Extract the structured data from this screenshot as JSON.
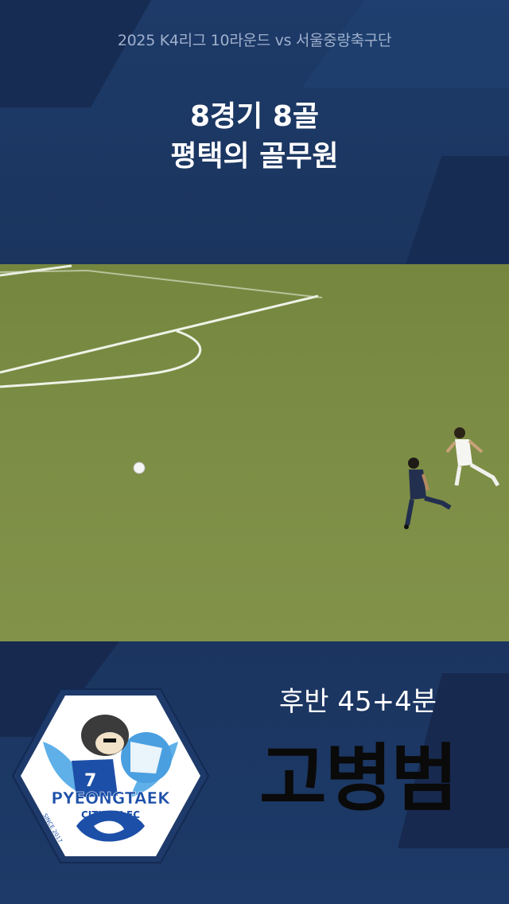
{
  "header": {
    "match_info": "2025 K4리그 10라운드 vs 서울중랑축구단",
    "headline_line1": "8경기 8골",
    "headline_line2": "평택의 골무원"
  },
  "caption": {
    "minute": "후반 45+4분",
    "player_name": "고병범"
  },
  "logo": {
    "name": "PYEONGTAEK",
    "sub": "CITIZEN FC",
    "since": "SINCE 2017",
    "jersey_number": "7"
  },
  "colors": {
    "navy": "#1c3663",
    "pitch": "#7b8c44",
    "logo_blue": "#1c4fa8"
  }
}
